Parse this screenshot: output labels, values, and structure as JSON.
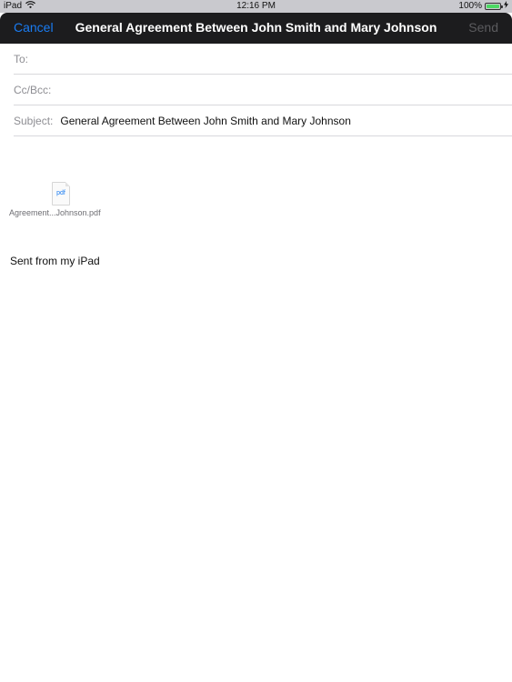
{
  "status_bar": {
    "device": "iPad",
    "wifi_icon": "wifi-icon",
    "time": "12:16 PM",
    "battery_percent": "100%",
    "battery_level": 1.0,
    "charging_icon": "bolt-icon"
  },
  "nav": {
    "cancel_label": "Cancel",
    "title": "General Agreement Between John Smith and Mary Johnson",
    "send_label": "Send"
  },
  "fields": {
    "to_label": "To:",
    "to_value": "",
    "cc_label": "Cc/Bcc:",
    "cc_value": "",
    "subject_label": "Subject:",
    "subject_value": "General Agreement Between John Smith and Mary Johnson"
  },
  "attachment": {
    "icon_text": "pdf",
    "file_name": "Agreement...Johnson.pdf"
  },
  "body": {
    "signature": "Sent from my iPad"
  },
  "colors": {
    "accent": "#1a7cf2",
    "nav_background": "#1c1c1e",
    "battery": "#4cd964"
  }
}
